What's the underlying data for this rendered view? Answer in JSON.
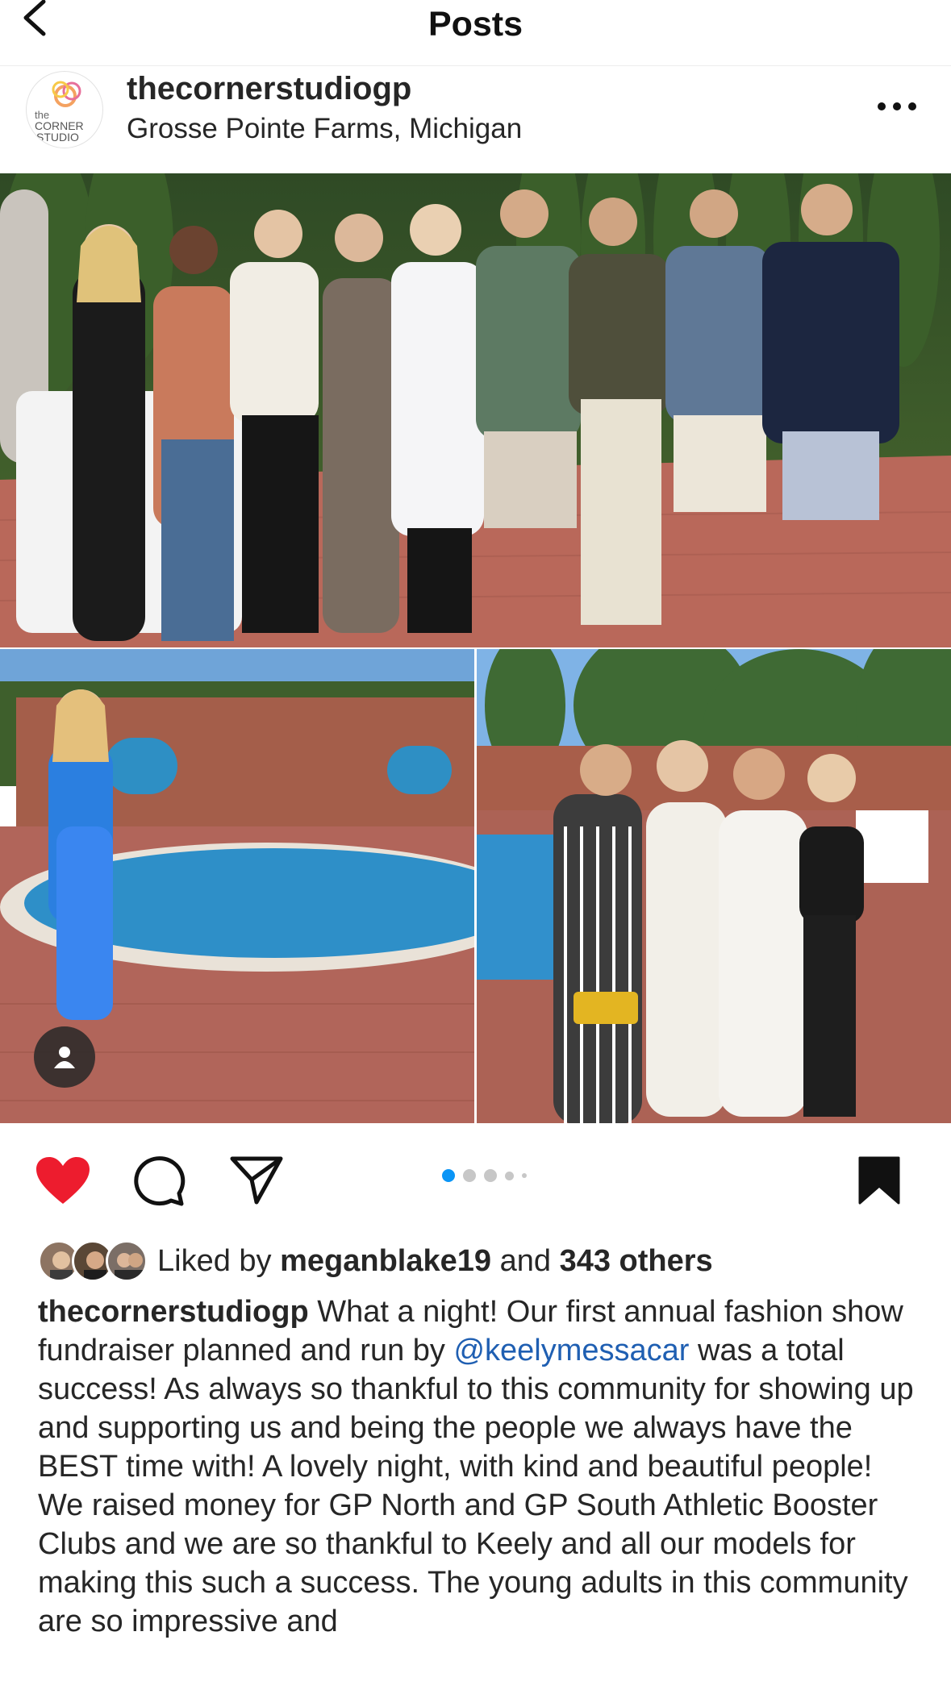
{
  "header": {
    "title": "Posts",
    "back_icon": "chevron-left-icon"
  },
  "post": {
    "username": "thecornerstudiogp",
    "location": "Grosse Pointe Farms, Michigan",
    "avatar_text": [
      "the",
      "CORNER",
      "STUDIO"
    ],
    "more_icon": "ellipsis-icon",
    "photos": [
      "Group photo of nine models standing in a garden on a brick patio",
      "Model in blue outfit posing beside a pool",
      "Four women posing together near the pool"
    ],
    "tag_icon": "person-tag-icon",
    "carousel": {
      "current": 1,
      "total": 5
    },
    "liked": true,
    "saved": true
  },
  "actions": {
    "like_icon": "heart-filled-icon",
    "comment_icon": "comment-icon",
    "share_icon": "send-icon",
    "save_icon": "bookmark-filled-icon"
  },
  "likes": {
    "prefix": "Liked by",
    "user": "meganblake19",
    "middle": "and",
    "others": "343 others"
  },
  "caption": {
    "username": "thecornerstudiogp",
    "part1": " What a night! Our first annual fashion show fundraiser planned and run by ",
    "mention": "@keelymessacar",
    "part2": " was a total success! As always so thankful to this community for showing up and supporting us and being the people we always have the BEST time with! A lovely night, with kind and beautiful people! We raised money for GP North and GP South Athletic Booster Clubs and we are so thankful to Keely and all our models for making this such a success. The young adults in this community are so impressive and"
  },
  "colors": {
    "heart": "#ed1c2e",
    "carousel_active": "#0a95f6",
    "carousel_inactive": "#c7c7c7",
    "mention": "#1f5fb2"
  }
}
